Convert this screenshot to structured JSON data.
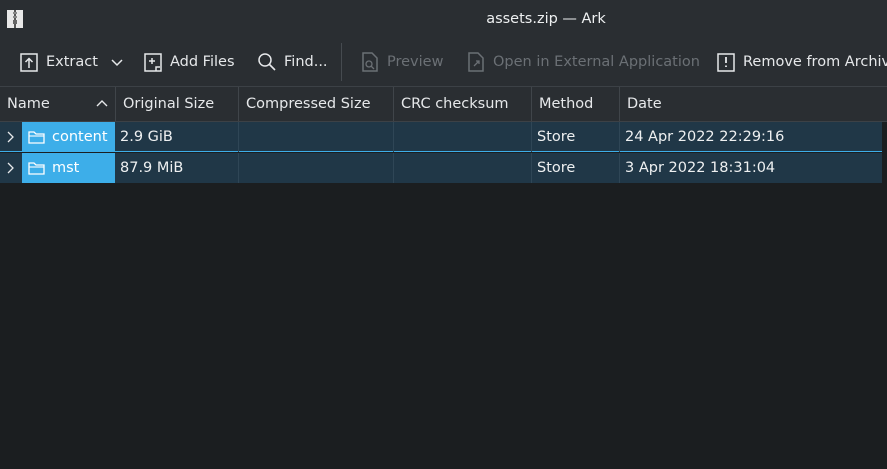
{
  "window": {
    "title": "assets.zip — Ark"
  },
  "toolbar": {
    "extract": "Extract",
    "add_files": "Add Files",
    "find": "Find...",
    "preview": "Preview",
    "open_external": "Open in External Application",
    "remove": "Remove from Archive"
  },
  "columns": {
    "name": "Name",
    "original_size": "Original Size",
    "compressed_size": "Compressed Size",
    "crc": "CRC checksum",
    "method": "Method",
    "date": "Date"
  },
  "rows": [
    {
      "name": "content",
      "original_size": "2.9 GiB",
      "compressed_size": "",
      "crc": "",
      "method": "Store",
      "date": "24 Apr 2022 22:29:16"
    },
    {
      "name": "mst",
      "original_size": "87.9 MiB",
      "compressed_size": "",
      "crc": "",
      "method": "Store",
      "date": "3 Apr 2022 18:31:04"
    }
  ],
  "colors": {
    "accent": "#3daee9",
    "selection_row": "#203747",
    "background": "#1b1e20",
    "toolbar": "#2a2e32"
  },
  "icons": [
    "zip-app-icon",
    "extract-icon",
    "chevron-down-icon",
    "add-files-icon",
    "search-icon",
    "preview-icon",
    "open-external-icon",
    "remove-icon",
    "sort-ascending-icon",
    "expand-chevron-icon",
    "folder-icon"
  ]
}
